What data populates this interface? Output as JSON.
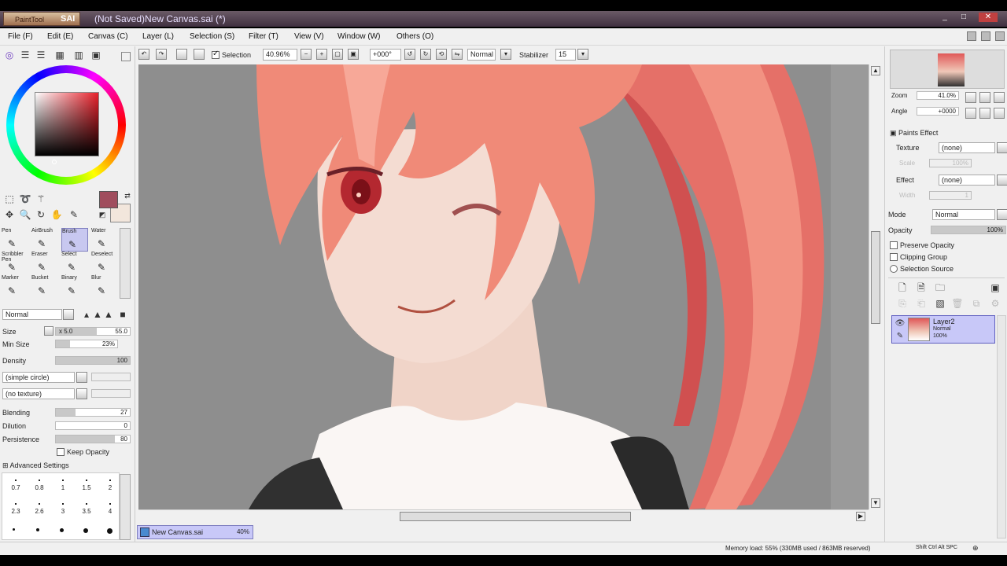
{
  "window": {
    "logo_small": "PaintTool",
    "logo": "SAI",
    "title": "(Not Saved)New Canvas.sai (*)"
  },
  "menu": [
    "File (F)",
    "Edit (E)",
    "Canvas (C)",
    "Layer (L)",
    "Selection (S)",
    "Filter (T)",
    "View (V)",
    "Window (W)",
    "Others (O)"
  ],
  "toolbar": {
    "selection_label": "Selection",
    "zoom": "40.96%",
    "angle": "+000°",
    "blend_mode": "Normal",
    "stabilizer_label": "Stabilizer",
    "stabilizer_value": "15"
  },
  "tools": {
    "brushes": [
      {
        "label": "Pen"
      },
      {
        "label": "AirBrush"
      },
      {
        "label": "Brush"
      },
      {
        "label": "Water"
      },
      {
        "label": "Scribbler Pen"
      },
      {
        "label": "Eraser"
      },
      {
        "label": "Select"
      },
      {
        "label": "Deselect"
      },
      {
        "label": "Marker"
      },
      {
        "label": "Bucket"
      },
      {
        "label": "Binary"
      },
      {
        "label": "Blur"
      }
    ],
    "selected_brush": "Brush",
    "mode": "Normal",
    "size_label": "Size",
    "size_mult": "x 5.0",
    "size_value": "55.0",
    "min_size_label": "Min Size",
    "min_size_value": "23%",
    "min_size_fill": 0.23,
    "density_label": "Density",
    "density_value": "100",
    "shape": "(simple circle)",
    "texture": "(no texture)",
    "blending_label": "Blending",
    "blending_value": "27",
    "dilution_label": "Dilution",
    "dilution_value": "0",
    "persistence_label": "Persistence",
    "persistence_value": "80",
    "keep_opacity_label": "Keep Opacity",
    "advanced_label": "Advanced Settings",
    "size_presets_row1": [
      "0.7",
      "0.8",
      "1",
      "1.5",
      "2"
    ],
    "size_presets_row2": [
      "2.3",
      "2.6",
      "3",
      "3.5",
      "4"
    ]
  },
  "colors": {
    "primary": "#a04d5d",
    "secondary": "#f2e6dc",
    "accent_tab": "#c8c8f8"
  },
  "document_tab": {
    "name": "New Canvas.sai",
    "zoom": "40%"
  },
  "right": {
    "zoom_label": "Zoom",
    "zoom_value": "41.0%",
    "angle_label": "Angle",
    "angle_value": "+0000",
    "paints_effect_label": "Paints Effect",
    "texture_label": "Texture",
    "texture_value": "(none)",
    "scale_label": "Scale",
    "scale_value": "100%",
    "effect_label": "Effect",
    "effect_value": "(none)",
    "width_label": "Width",
    "width_value": "1",
    "mode_label": "Mode",
    "mode_value": "Normal",
    "opacity_label": "Opacity",
    "opacity_value": "100%",
    "preserve_opacity_label": "Preserve Opacity",
    "clipping_group_label": "Clipping Group",
    "selection_source_label": "Selection Source",
    "layer": {
      "name": "Layer2",
      "mode": "Normal",
      "opacity": "100%"
    }
  },
  "status": {
    "memory": "Memory load: 55% (330MB used / 863MB reserved)",
    "keys": "Shift Ctrl Alt SPC"
  }
}
